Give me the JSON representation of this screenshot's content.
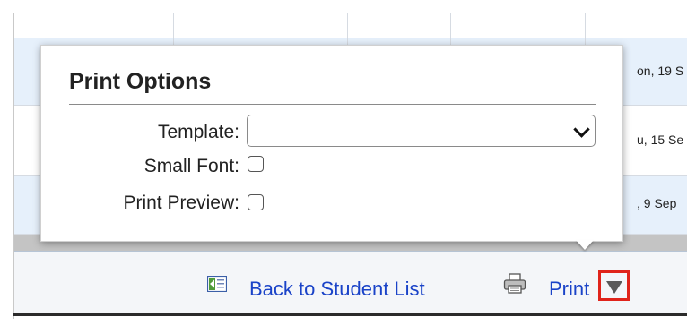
{
  "table": {
    "dates": [
      "on, 19 S",
      "u, 15 Se",
      ", 9 Sep"
    ]
  },
  "print_options": {
    "title": "Print Options",
    "template_label": "Template:",
    "template_value": "",
    "small_font_label": "Small Font:",
    "small_font_checked": false,
    "print_preview_label": "Print Preview:",
    "print_preview_checked": false
  },
  "footer": {
    "back_link": "Back to Student List",
    "print_link": "Print"
  },
  "icons": {
    "back": "back-arrow-icon",
    "print": "printer-icon",
    "menu": "dropdown-triangle-icon"
  },
  "colors": {
    "link": "#1a43c8",
    "row_highlight": "#e6f0fb",
    "callout": "#e0241b"
  }
}
